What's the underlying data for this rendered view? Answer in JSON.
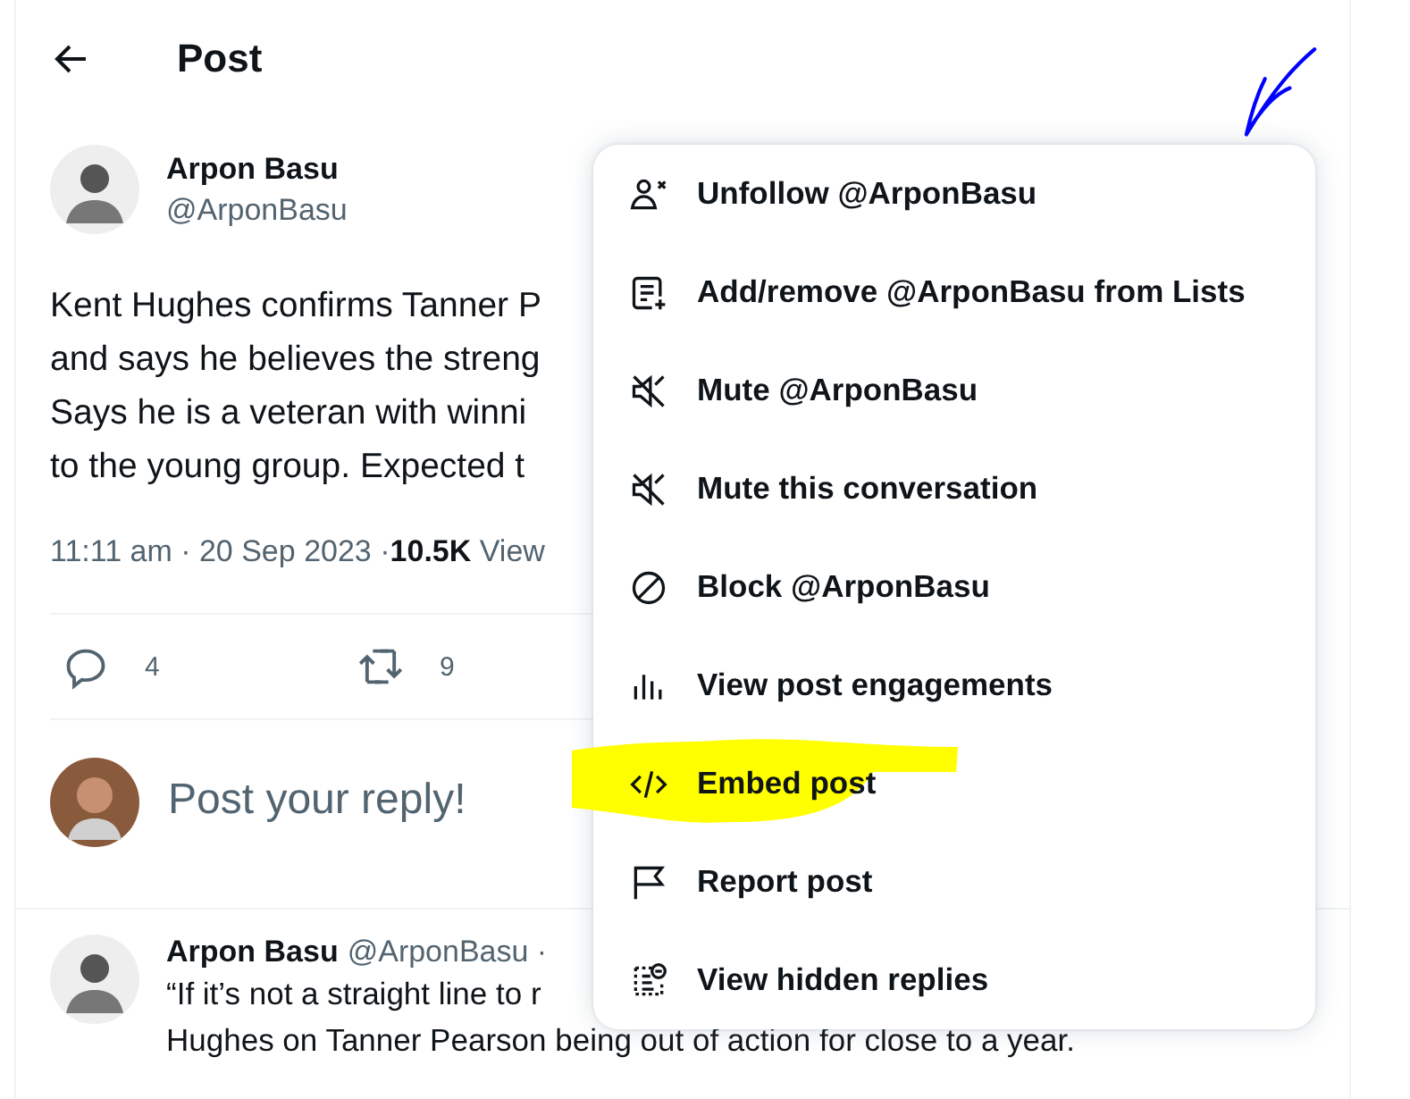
{
  "header": {
    "title": "Post"
  },
  "post": {
    "author": "Arpon Basu",
    "handle": "@ArponBasu",
    "lines": [
      "Kent Hughes confirms Tanner P",
      "and says he believes the streng",
      "Says he is a veteran with winni",
      "to the young group. Expected t"
    ],
    "time": "11:11 am · 20 Sep 2023 · ",
    "views": "10.5K",
    "views_label": "View",
    "replies": "4",
    "reposts": "9"
  },
  "reply_box": {
    "placeholder": "Post your reply!"
  },
  "reply": {
    "author": "Arpon Basu",
    "handle": "@ArponBasu ·",
    "lines": [
      "“If it’s not a straight line to r",
      "Hughes on Tanner Pearson being out of action for close to a year."
    ]
  },
  "menu": {
    "items": [
      {
        "kind": "unfollow",
        "label": "Unfollow @ArponBasu",
        "highlighted": false
      },
      {
        "kind": "lists",
        "label": "Add/remove @ArponBasu from Lists",
        "highlighted": false
      },
      {
        "kind": "mute",
        "label": "Mute @ArponBasu",
        "highlighted": false
      },
      {
        "kind": "mute",
        "label": "Mute this conversation",
        "highlighted": false
      },
      {
        "kind": "block",
        "label": "Block @ArponBasu",
        "highlighted": false
      },
      {
        "kind": "stats",
        "label": "View post engagements",
        "highlighted": false
      },
      {
        "kind": "embed",
        "label": "Embed post",
        "highlighted": true
      },
      {
        "kind": "report",
        "label": "Report post",
        "highlighted": false
      },
      {
        "kind": "hidden",
        "label": "View hidden replies",
        "highlighted": false
      }
    ]
  }
}
